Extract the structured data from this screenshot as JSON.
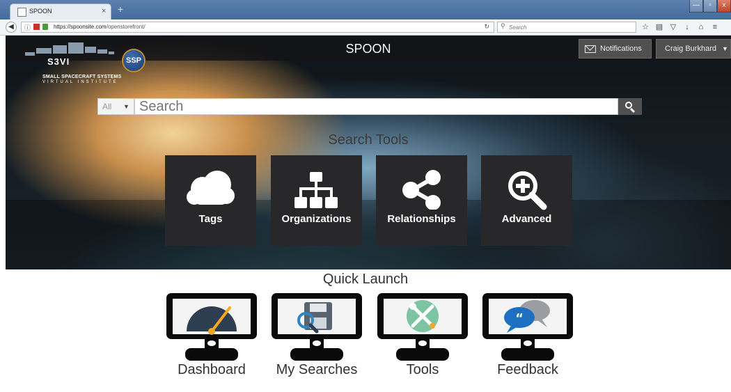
{
  "browser": {
    "tab_title": "SPOON",
    "tab_close": "×",
    "new_tab": "+",
    "url_host": "https://spoonsite.com",
    "url_path": "/openstorefront/",
    "search_placeholder": "Search",
    "window_controls": {
      "minimize": "—",
      "maximize": "▫",
      "close": "x"
    }
  },
  "header": {
    "title": "SPOON",
    "notifications_label": "Notifications",
    "user_name": "Craig Burkhard",
    "logo": {
      "name": "S3VI",
      "subtitle_line1": "SMALL SPACECRAFT SYSTEMS",
      "subtitle_line2": "VIRTUAL INSTITUTE",
      "badge": "SSP"
    }
  },
  "search": {
    "category": "All",
    "placeholder": "Search"
  },
  "search_tools": {
    "heading": "Search Tools",
    "tiles": [
      {
        "label": "Tags",
        "icon": "cloud-icon"
      },
      {
        "label": "Organizations",
        "icon": "org-chart-icon"
      },
      {
        "label": "Relationships",
        "icon": "share-icon"
      },
      {
        "label": "Advanced",
        "icon": "zoom-plus-icon"
      }
    ]
  },
  "quick_launch": {
    "heading": "Quick Launch",
    "items": [
      {
        "label": "Dashboard",
        "icon": "dashboard-gauge-icon"
      },
      {
        "label": "My Searches",
        "icon": "saved-search-icon"
      },
      {
        "label": "Tools",
        "icon": "tools-icon"
      },
      {
        "label": "Feedback",
        "icon": "feedback-bubbles-icon"
      }
    ]
  },
  "colors": {
    "tile_bg": "#28282a",
    "header_btn": "#505050",
    "gauge_needle": "#f5a623",
    "tools_circle": "#7dc4a2",
    "feedback_blue": "#1d6fc2"
  }
}
